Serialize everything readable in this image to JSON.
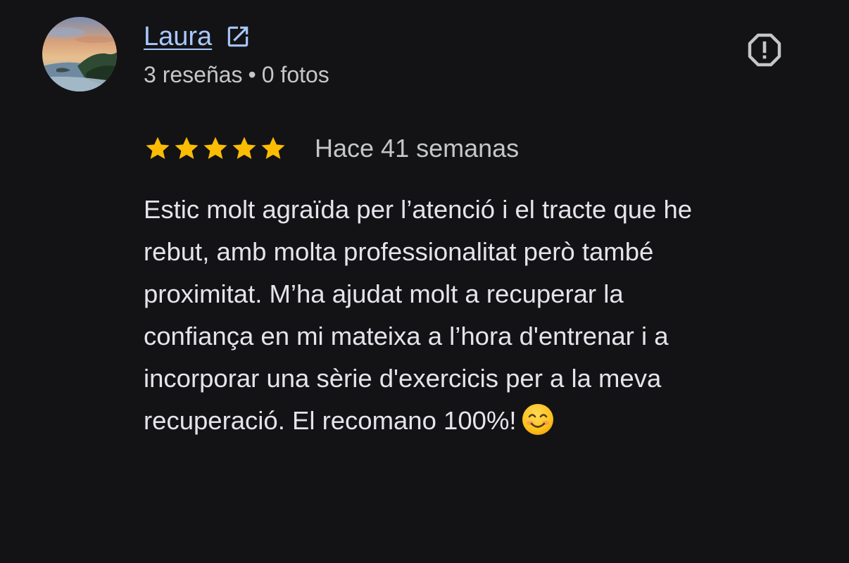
{
  "review": {
    "author": {
      "name": "Laura",
      "reviews_count": "3 reseñas",
      "separator": "•",
      "photos_count": "0 fotos"
    },
    "icons": {
      "avatar": "profile-photo",
      "external_link": "open-in-new-icon",
      "report": "report-icon",
      "emoji": "smiling-face-emoji"
    },
    "rating": {
      "stars": 5,
      "max_stars": 5
    },
    "time": "Hace 41 semanas",
    "text_lines": [
      "Estic molt agraïda per l’atenció i el tracte que he",
      "rebut, amb molta professionalitat però també",
      "proximitat. M’ha ajudat molt a recuperar la",
      "confiança en mi mateixa a l’hora d'entrenar i a",
      "incorporar una sèrie d'exercicis per a la meva",
      "recuperació. El recomano 100%!"
    ],
    "colors": {
      "background": "#131316",
      "link": "#a8c7fa",
      "star": "#fbbc04",
      "secondary_text": "#c4c7c5",
      "primary_text": "#e6e4ea"
    }
  }
}
